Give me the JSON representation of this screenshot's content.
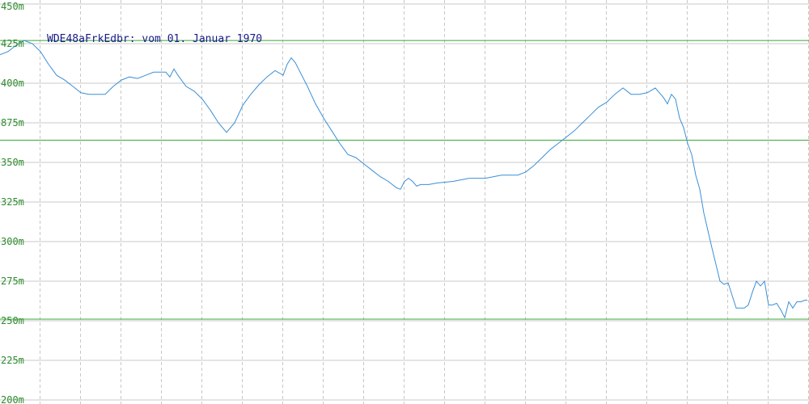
{
  "chart_data": {
    "type": "line",
    "title": "WDE48aFrkEdbr: vom 01. Januar 1970",
    "xlabel": "",
    "ylabel": "",
    "ylim": [
      200,
      450
    ],
    "xlim": [
      0,
      1000
    ],
    "y_ticks": [
      450,
      425,
      400,
      375,
      350,
      325,
      300,
      275,
      250,
      225,
      200
    ],
    "y_tick_labels": [
      "450m",
      "425m",
      "400m",
      "875m",
      "350m",
      "325m",
      "300m",
      "275m",
      "250m",
      "225m",
      "200m"
    ],
    "x_gridlines": 20,
    "grid": true,
    "reference_lines": [
      427,
      364,
      251
    ],
    "colors": {
      "line": "#3a8fd6",
      "reference": "#3aa83a",
      "grid": "#c8c8c8",
      "title": "#1a1a8c",
      "ticks": "#2e8b2e"
    },
    "series": [
      {
        "x": [
          0,
          10,
          20,
          30,
          40,
          50,
          60,
          70,
          80,
          90,
          100,
          110,
          120,
          130,
          140,
          150,
          160,
          170,
          180,
          190,
          200,
          205,
          210,
          215,
          220,
          230,
          240,
          250,
          260,
          270,
          280,
          290,
          300,
          310,
          320,
          330,
          340,
          350,
          355,
          360,
          365,
          370,
          380,
          390,
          400,
          410,
          420,
          430,
          440,
          450,
          460,
          470,
          480,
          490,
          495,
          500,
          505,
          510,
          515,
          520,
          530,
          540,
          560,
          580,
          600,
          620,
          640,
          650,
          660,
          670,
          680,
          690,
          700,
          710,
          720,
          730,
          740,
          750,
          760,
          770,
          780,
          790,
          800,
          810,
          820,
          825,
          830,
          835,
          840,
          845,
          850,
          855,
          860,
          865,
          870,
          880,
          890,
          895,
          900,
          905,
          910,
          915,
          920,
          925,
          930,
          935,
          940,
          945,
          950,
          955,
          960,
          965,
          970,
          975,
          980,
          985,
          990,
          995,
          998
        ],
        "y": [
          418,
          420,
          424,
          427,
          425,
          420,
          412,
          405,
          402,
          398,
          394,
          393,
          393,
          393,
          398,
          402,
          404,
          403,
          405,
          407,
          407,
          407,
          404,
          409,
          405,
          398,
          395,
          390,
          383,
          375,
          369,
          375,
          386,
          393,
          399,
          404,
          408,
          405,
          412,
          416,
          413,
          408,
          398,
          387,
          378,
          370,
          362,
          355,
          353,
          349,
          345,
          341,
          338,
          334,
          333,
          338,
          340,
          338,
          335,
          336,
          336,
          337,
          338,
          340,
          340,
          342,
          342,
          344,
          348,
          353,
          358,
          362,
          366,
          370,
          375,
          380,
          385,
          388,
          393,
          397,
          393,
          393,
          394,
          397,
          391,
          387,
          393,
          390,
          378,
          372,
          362,
          355,
          342,
          333,
          318,
          296,
          275,
          273,
          274,
          266,
          258,
          258,
          258,
          260,
          268,
          275,
          272,
          275,
          260,
          260,
          261,
          257,
          252,
          262,
          258,
          262,
          262,
          263,
          263
        ]
      }
    ]
  }
}
